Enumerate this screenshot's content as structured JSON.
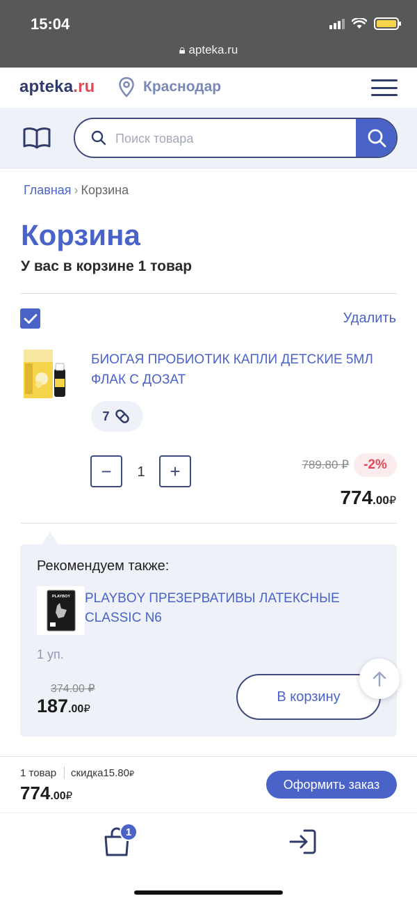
{
  "status": {
    "time": "15:04",
    "url": "apteka.ru"
  },
  "header": {
    "logo_main": "apteka",
    "logo_suffix": ".ru",
    "city": "Краснодар"
  },
  "search": {
    "placeholder": "Поиск товара"
  },
  "breadcrumb": {
    "home": "Главная",
    "separator": "›",
    "current": "Корзина"
  },
  "page": {
    "title": "Корзина",
    "subtitle": "У вас в корзине 1 товар"
  },
  "cart_item": {
    "delete_label": "Удалить",
    "name": "БИОГАЯ ПРОБИОТИК КАПЛИ ДЕТСКИЕ 5МЛ ФЛАК С ДОЗАТ",
    "bonus": "7",
    "quantity": "1",
    "minus": "−",
    "plus": "+",
    "old_price": "789.80 ₽",
    "discount": "-2%",
    "price_int": "774",
    "price_dec": ".00",
    "currency": "₽",
    "checked": true
  },
  "recommend": {
    "title": "Рекомендуем также:",
    "name": "PLAYBOY ПРЕЗЕРВАТИВЫ ЛАТЕКСНЫЕ CLASSIC N6",
    "unit": "1 уп.",
    "old_price": "374.00 ₽",
    "price_int": "187",
    "price_dec": ".00",
    "currency": "₽",
    "button": "В корзину",
    "package_text": "PLAYBOY"
  },
  "footer": {
    "count": "1 товар",
    "discount_label": "скидка",
    "discount_value": "15.80",
    "currency": "₽",
    "total_int": "774",
    "total_dec": ".00",
    "checkout": "Оформить заказ"
  },
  "tabbar": {
    "cart_badge": "1"
  },
  "colors": {
    "accent": "#4a63c9",
    "dark": "#2f3b6b",
    "red": "#e04b58",
    "panel": "#eef1f8"
  }
}
